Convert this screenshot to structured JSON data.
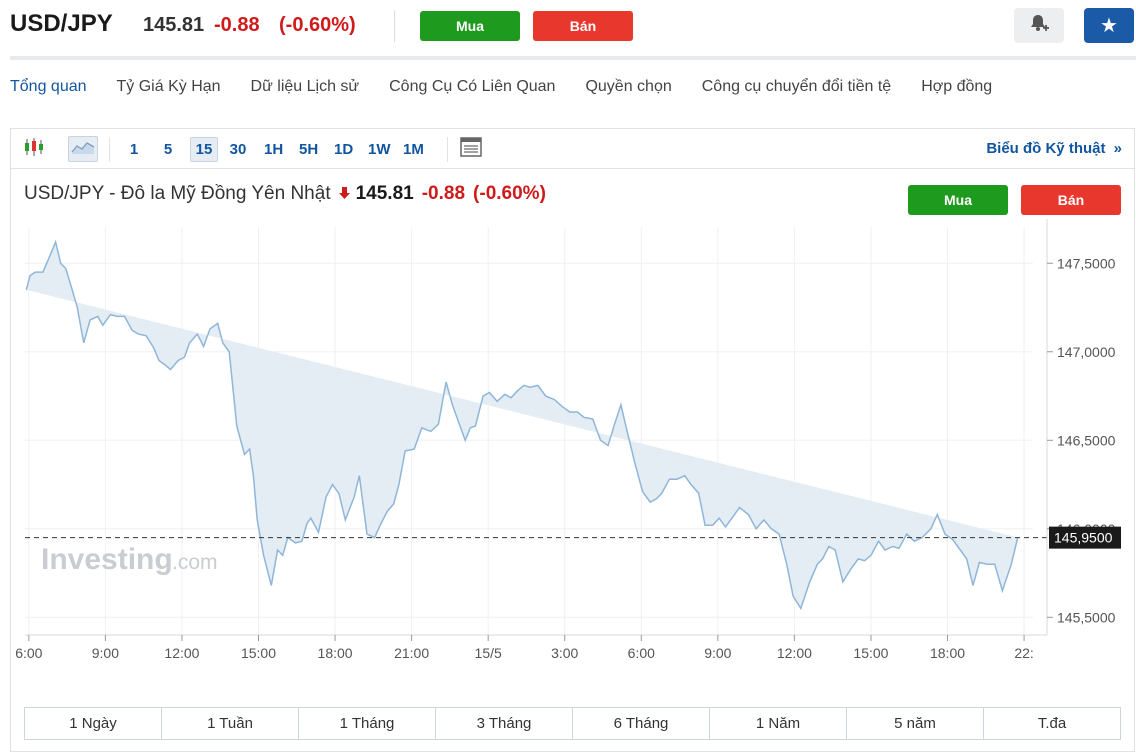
{
  "header": {
    "symbol": "USD/JPY",
    "last": "145.81",
    "change": "-0.88",
    "change_pct": "(-0.60%)",
    "buy_label": "Mua",
    "sell_label": "Bán",
    "alert_icon": "bell-plus-icon",
    "watchlist_icon": "star-icon"
  },
  "nav": {
    "tabs": [
      "Tổng quan",
      "Tỷ Giá Kỳ Hạn",
      "Dữ liệu Lịch sử",
      "Công Cụ Có Liên Quan",
      "Quyền chọn",
      "Công cụ chuyển đổi tiền tệ",
      "Hợp đồng"
    ],
    "active": 0
  },
  "toolbar": {
    "chart_type_icons": [
      "candlestick-icon",
      "area-chart-icon"
    ],
    "intervals": [
      "1",
      "5",
      "15",
      "30",
      "1H",
      "5H",
      "1D",
      "1W",
      "1M"
    ],
    "selected_interval": "15",
    "table_icon": "table-icon",
    "technical_link": "Biểu đồ Kỹ thuật",
    "technical_chevron": "»"
  },
  "chart_header": {
    "title": "USD/JPY - Đô la Mỹ Đồng Yên Nhật",
    "direction_icon": "down-arrow-icon",
    "last": "145.81",
    "change": "-0.88",
    "change_pct": "(-0.60%)",
    "buy_label": "Mua",
    "sell_label": "Bán"
  },
  "watermark": {
    "brand": "Investing",
    "suffix": ".com"
  },
  "colors": {
    "line": "#8fb6d9",
    "fill": "#e4ecf4",
    "negative": "#d11a1a",
    "buy": "#1e9a1e",
    "sell": "#e8372c",
    "link": "#1256a0"
  },
  "chart_data": {
    "type": "area",
    "ylim": [
      145.4,
      147.75
    ],
    "yticks": [
      "147,5000",
      "147,0000",
      "146,5000",
      "146,0000",
      "145,5000"
    ],
    "ytick_values": [
      147.5,
      147.0,
      146.5,
      146.0,
      145.5
    ],
    "current_label": "145,9500",
    "current_value": 145.95,
    "xtick_labels": [
      "6:00",
      "9:00",
      "12:00",
      "15:00",
      "18:00",
      "21:00",
      "15/5",
      "3:00",
      "6:00",
      "9:00",
      "12:00",
      "15:00",
      "18:00",
      "22:"
    ],
    "xtick_positions": [
      0.0,
      3.0,
      6.0,
      9.0,
      12.0,
      15.0,
      18.0,
      21.0,
      24.0,
      27.0,
      30.0,
      33.0,
      36.0,
      39.0
    ],
    "x": [
      -0.1,
      0.05,
      0.25,
      0.55,
      0.85,
      1.05,
      1.25,
      1.45,
      1.7,
      1.9,
      2.15,
      2.4,
      2.7,
      2.9,
      3.2,
      3.45,
      3.75,
      4.05,
      4.3,
      4.6,
      4.9,
      5.1,
      5.3,
      5.55,
      5.85,
      6.1,
      6.3,
      6.6,
      6.85,
      7.1,
      7.4,
      7.6,
      7.85,
      8.15,
      8.45,
      8.65,
      8.8,
      8.95,
      9.2,
      9.5,
      9.75,
      9.95,
      10.15,
      10.45,
      10.7,
      10.9,
      11.05,
      11.35,
      11.65,
      11.9,
      12.15,
      12.4,
      12.75,
      12.95,
      13.25,
      13.55,
      13.8,
      14.05,
      14.3,
      14.5,
      14.75,
      15.1,
      15.4,
      15.75,
      16.05,
      16.35,
      16.6,
      16.85,
      17.1,
      17.3,
      17.5,
      17.8,
      18.05,
      18.35,
      18.65,
      18.9,
      19.15,
      19.4,
      19.65,
      19.95,
      20.25,
      20.6,
      20.9,
      21.2,
      21.5,
      21.75,
      22.1,
      22.4,
      22.7,
      22.95,
      23.2,
      23.45,
      23.75,
      24.05,
      24.35,
      24.6,
      24.8,
      25.1,
      25.4,
      25.7,
      25.95,
      26.25,
      26.5,
      26.8,
      27.05,
      27.3,
      27.55,
      27.85,
      28.2,
      28.5,
      28.8,
      29.1,
      29.4,
      29.7,
      29.95,
      30.25,
      30.6,
      30.9,
      31.1,
      31.35,
      31.6,
      31.9,
      32.2,
      32.5,
      32.75,
      33.0,
      33.3,
      33.55,
      33.85,
      34.1,
      34.4,
      34.7,
      35.0,
      35.35,
      35.6,
      35.9,
      36.2,
      36.5,
      36.75,
      37.0,
      37.25,
      37.55,
      37.85,
      38.15,
      38.5,
      38.75,
      39.0,
      39.2
    ],
    "values": [
      147.35,
      147.43,
      147.45,
      147.45,
      147.55,
      147.62,
      147.5,
      147.47,
      147.35,
      147.25,
      147.05,
      147.18,
      147.2,
      147.15,
      147.21,
      147.2,
      147.2,
      147.12,
      147.1,
      147.09,
      147.02,
      146.95,
      146.93,
      146.9,
      146.95,
      146.97,
      147.05,
      147.1,
      147.03,
      147.13,
      147.16,
      147.05,
      147.0,
      146.58,
      146.42,
      146.45,
      146.3,
      146.05,
      145.85,
      145.68,
      145.88,
      145.85,
      145.95,
      145.92,
      145.93,
      146.03,
      146.06,
      145.98,
      146.18,
      146.25,
      146.2,
      146.05,
      146.18,
      146.3,
      145.97,
      145.95,
      146.03,
      146.1,
      146.14,
      146.25,
      146.44,
      146.45,
      146.57,
      146.55,
      146.59,
      146.83,
      146.7,
      146.6,
      146.5,
      146.57,
      146.58,
      146.75,
      146.77,
      146.72,
      146.76,
      146.74,
      146.78,
      146.81,
      146.8,
      146.81,
      146.75,
      146.73,
      146.69,
      146.66,
      146.66,
      146.63,
      146.62,
      146.5,
      146.47,
      146.59,
      146.7,
      146.55,
      146.37,
      146.21,
      146.15,
      146.17,
      146.2,
      146.28,
      146.28,
      146.3,
      146.25,
      146.2,
      146.02,
      146.02,
      146.06,
      146.01,
      146.06,
      146.12,
      146.08,
      146.0,
      146.05,
      146.0,
      145.97,
      145.8,
      145.62,
      145.55,
      145.7,
      145.8,
      145.83,
      145.9,
      145.88,
      145.7,
      145.77,
      145.83,
      145.82,
      145.85,
      145.93,
      145.88,
      145.9,
      145.89,
      145.97,
      145.93,
      145.95,
      146.0,
      146.08,
      145.97,
      145.94,
      145.88,
      145.83,
      145.68,
      145.81,
      145.8,
      145.8,
      145.65,
      145.8,
      145.95
    ]
  }
}
